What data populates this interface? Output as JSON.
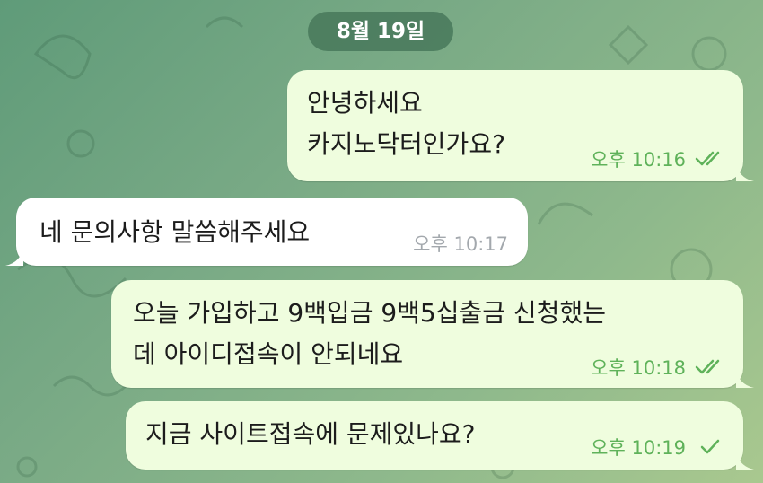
{
  "date_label": "8월 19일",
  "messages": [
    {
      "direction": "out",
      "lines": [
        "안녕하세요",
        "카지노닥터인가요?"
      ],
      "time": "오후 10:16",
      "status": "read"
    },
    {
      "direction": "in",
      "lines": [
        "네 문의사항 말씀해주세요"
      ],
      "time": "오후 10:17"
    },
    {
      "direction": "out",
      "lines": [
        "오늘 가입하고 9백입금 9백5십출금 신청했는",
        "데 아이디접속이 안되네요"
      ],
      "time": "오후 10:18",
      "status": "read"
    },
    {
      "direction": "out",
      "lines": [
        "지금 사이트접속에 문제있나요?"
      ],
      "time": "오후 10:19",
      "status": "sent"
    }
  ],
  "colors": {
    "outgoing_bubble": "#effdde",
    "incoming_bubble": "#ffffff",
    "outgoing_meta": "#5fb25a",
    "incoming_meta": "#a3a8ad",
    "date_pill": "#48785a"
  },
  "icons": {
    "read": "double-check-icon",
    "sent": "single-check-icon"
  }
}
